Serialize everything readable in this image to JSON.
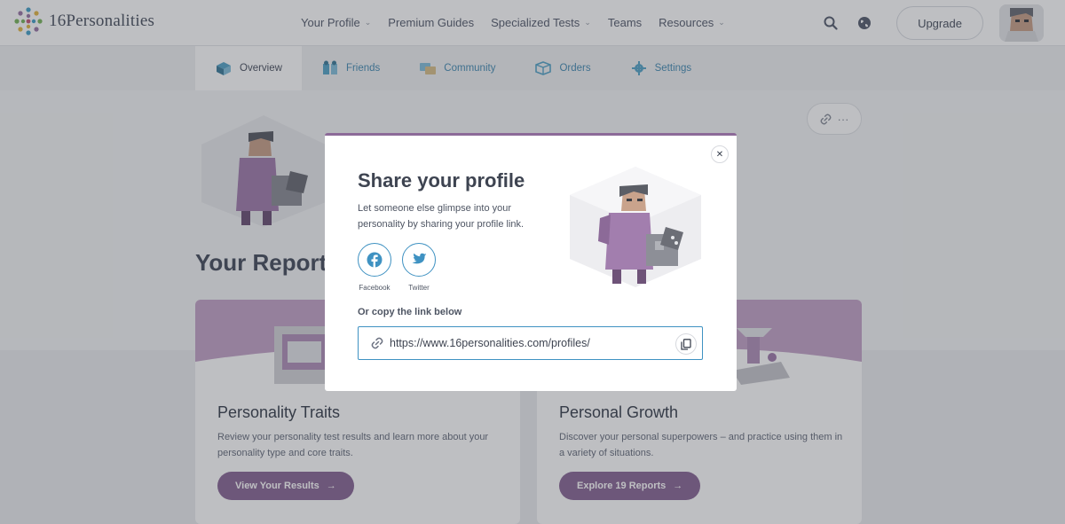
{
  "brand": {
    "logo_text": "16Personalities",
    "accent": "#8c6a98",
    "link_color": "#3f92c2"
  },
  "nav": {
    "items": [
      {
        "label": "Your Profile",
        "has_caret": true
      },
      {
        "label": "Premium Guides",
        "has_caret": false
      },
      {
        "label": "Specialized Tests",
        "has_caret": true
      },
      {
        "label": "Teams",
        "has_caret": false
      },
      {
        "label": "Resources",
        "has_caret": true
      }
    ],
    "upgrade_label": "Upgrade"
  },
  "subnav": {
    "tabs": [
      {
        "label": "Overview",
        "icon": "overview-icon",
        "active": true
      },
      {
        "label": "Friends",
        "icon": "friends-icon",
        "active": false
      },
      {
        "label": "Community",
        "icon": "community-icon",
        "active": false
      },
      {
        "label": "Orders",
        "icon": "orders-icon",
        "active": false
      },
      {
        "label": "Settings",
        "icon": "settings-icon",
        "active": false
      }
    ]
  },
  "page": {
    "reports_title": "Your Reports",
    "cards": [
      {
        "title": "Personality Traits",
        "description": "Review your personality test results and learn more about your personality type and core traits.",
        "button": "View Your Results"
      },
      {
        "title": "Personal Growth",
        "description": "Discover your personal superpowers – and practice using them in a variety of situations.",
        "button": "Explore 19 Reports"
      }
    ]
  },
  "modal": {
    "title": "Share your profile",
    "description": "Let someone else glimpse into your personality by sharing your profile link.",
    "social": [
      {
        "label": "Facebook",
        "icon": "facebook-icon"
      },
      {
        "label": "Twitter",
        "icon": "twitter-icon"
      }
    ],
    "copy_label": "Or copy the link below",
    "link_value": "https://www.16personalities.com/profiles/"
  }
}
